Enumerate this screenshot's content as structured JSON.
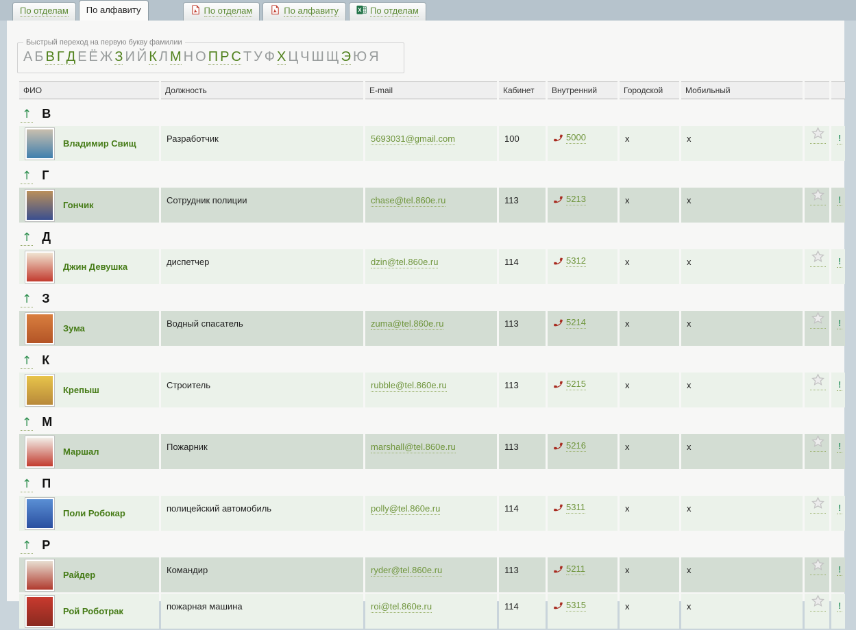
{
  "tabs": [
    {
      "label": "По отделам",
      "icon": null,
      "active": false
    },
    {
      "label": "По алфавиту",
      "icon": null,
      "active": true
    },
    {
      "label": "По отделам",
      "icon": "pdf",
      "active": false
    },
    {
      "label": "По алфавиту",
      "icon": "pdf",
      "active": false
    },
    {
      "label": "По отделам",
      "icon": "excel",
      "active": false
    }
  ],
  "quick_nav": {
    "legend": "Быстрый переход на первую букву фамилии",
    "letters": [
      {
        "char": "А",
        "active": false
      },
      {
        "char": "Б",
        "active": false
      },
      {
        "char": "В",
        "active": true
      },
      {
        "char": "Г",
        "active": true
      },
      {
        "char": "Д",
        "active": true
      },
      {
        "char": "Е",
        "active": false
      },
      {
        "char": "Ё",
        "active": false
      },
      {
        "char": "Ж",
        "active": false
      },
      {
        "char": "З",
        "active": true
      },
      {
        "char": "И",
        "active": false
      },
      {
        "char": "Й",
        "active": false
      },
      {
        "char": "К",
        "active": true
      },
      {
        "char": "Л",
        "active": false
      },
      {
        "char": "М",
        "active": true
      },
      {
        "char": "Н",
        "active": false
      },
      {
        "char": "О",
        "active": false
      },
      {
        "char": "П",
        "active": true
      },
      {
        "char": "Р",
        "active": true
      },
      {
        "char": "С",
        "active": true
      },
      {
        "char": "Т",
        "active": false
      },
      {
        "char": "У",
        "active": false
      },
      {
        "char": "Ф",
        "active": false
      },
      {
        "char": "Х",
        "active": true
      },
      {
        "char": "Ц",
        "active": false
      },
      {
        "char": "Ч",
        "active": false
      },
      {
        "char": "Ш",
        "active": false
      },
      {
        "char": "Щ",
        "active": false
      },
      {
        "char": "Э",
        "active": true
      },
      {
        "char": "Ю",
        "active": false
      },
      {
        "char": "Я",
        "active": false
      }
    ]
  },
  "table": {
    "headers": [
      "ФИО",
      "Должность",
      "E-mail",
      "Кабинет",
      "Внутренний",
      "Городской",
      "Мобильный",
      "",
      ""
    ],
    "up_arrow": "↑",
    "bang": "!",
    "groups": [
      {
        "letter": "В",
        "rows": [
          {
            "name": "Владимир Свищ",
            "position": "Разработчик",
            "email": "5693031@gmail.com",
            "room": "100",
            "internal": "5000",
            "city": "x",
            "mobile": "x",
            "avatar": "man-in-blue-jacket-photo",
            "avatar_colors": [
              "#c9bfae",
              "#3f7fae"
            ]
          }
        ]
      },
      {
        "letter": "Г",
        "rows": [
          {
            "name": "Гончик",
            "position": "Сотрудник полиции",
            "email": "chase@tel.860e.ru",
            "room": "113",
            "internal": "5213",
            "city": "x",
            "mobile": "x",
            "avatar": "police-pup-cartoon",
            "avatar_colors": [
              "#b98f5a",
              "#3a4f8f"
            ]
          }
        ]
      },
      {
        "letter": "Д",
        "rows": [
          {
            "name": "Джин Девушка",
            "position": "диспетчер",
            "email": "dzin@tel.860e.ru",
            "room": "114",
            "internal": "5312",
            "city": "x",
            "mobile": "x",
            "avatar": "girl-cartoon",
            "avatar_colors": [
              "#f0e4d2",
              "#c23b2e"
            ]
          }
        ]
      },
      {
        "letter": "З",
        "rows": [
          {
            "name": "Зума",
            "position": "Водный спасатель",
            "email": "zuma@tel.860e.ru",
            "room": "113",
            "internal": "5214",
            "city": "x",
            "mobile": "x",
            "avatar": "orange-pup-cartoon",
            "avatar_colors": [
              "#d97f3f",
              "#b35426"
            ]
          }
        ]
      },
      {
        "letter": "К",
        "rows": [
          {
            "name": "Крепыш",
            "position": "Строитель",
            "email": "rubble@tel.860e.ru",
            "room": "113",
            "internal": "5215",
            "city": "x",
            "mobile": "x",
            "avatar": "builder-pup-cartoon",
            "avatar_colors": [
              "#e8c44a",
              "#b8893a"
            ]
          }
        ]
      },
      {
        "letter": "М",
        "rows": [
          {
            "name": "Маршал",
            "position": "Пожарник",
            "email": "marshall@tel.860e.ru",
            "room": "113",
            "internal": "5216",
            "city": "x",
            "mobile": "x",
            "avatar": "dalmatian-pup-cartoon",
            "avatar_colors": [
              "#f2efe9",
              "#c23b2e"
            ]
          }
        ]
      },
      {
        "letter": "П",
        "rows": [
          {
            "name": "Поли Робокар",
            "position": "полицейский автомобиль",
            "email": "polly@tel.860e.ru",
            "room": "114",
            "internal": "5311",
            "city": "x",
            "mobile": "x",
            "avatar": "blue-robot-car-cartoon",
            "avatar_colors": [
              "#5a8fd4",
              "#2a4fa0"
            ]
          }
        ]
      },
      {
        "letter": "Р",
        "rows": [
          {
            "name": "Райдер",
            "position": "Командир",
            "email": "ryder@tel.860e.ru",
            "room": "113",
            "internal": "5211",
            "city": "x",
            "mobile": "x",
            "avatar": "boy-cartoon",
            "avatar_colors": [
              "#e8dfd2",
              "#b03a2e"
            ]
          },
          {
            "name": "Рой Роботрак",
            "position": "пожарная машина",
            "email": "roi@tel.860e.ru",
            "room": "114",
            "internal": "5315",
            "city": "x",
            "mobile": "x",
            "avatar": "red-robot-truck-cartoon",
            "avatar_colors": [
              "#c83a2e",
              "#8a2a20"
            ]
          }
        ]
      }
    ]
  }
}
